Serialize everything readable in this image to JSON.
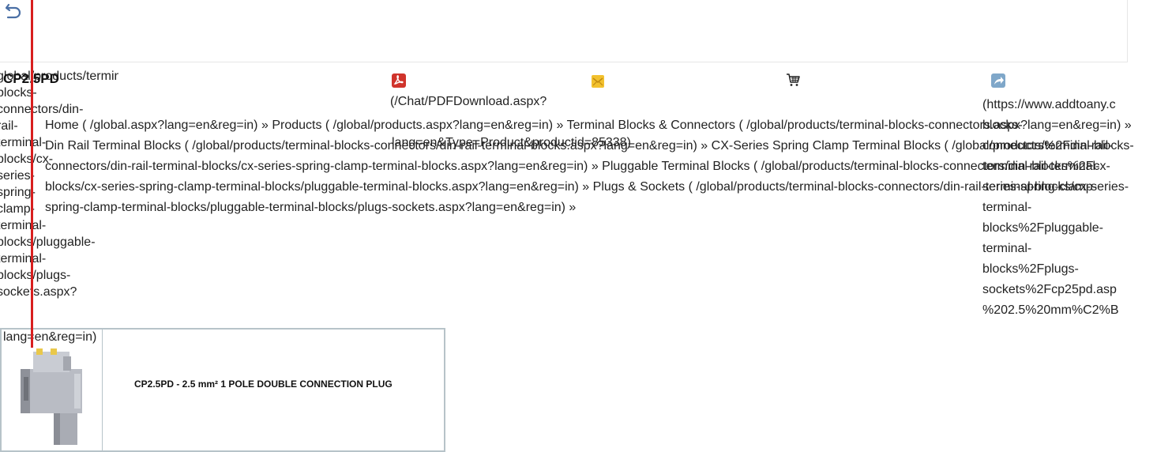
{
  "left_url": {
    "lines": [
      "global/products/terminal-",
      "blocks-",
      "connectors/din-",
      "rail-",
      "terminal-",
      "blocks/cx-",
      "series-",
      "spring-",
      "clamp-",
      "terminal-",
      "blocks/pluggable-",
      "terminal-",
      "blocks/plugs-",
      "sockets.aspx?",
      "lang=en&reg=in)"
    ]
  },
  "product_code": "CP2.5PD",
  "share": {
    "pdf_icon": "pdf-icon",
    "mail_icon": "mail-icon",
    "cart_icon": "cart-icon",
    "share_icon": "share-arrow-icon",
    "pdf_url_line1": "(/Chat/PDFDownload.aspx?",
    "pdf_url_line2": "lang=en&Type=Product&productid=85338)",
    "addtoany_lines": [
      "(https://www.addtoany.c",
      "blocks-",
      "connectors%2Fdin-rail-",
      "terminal-blocks%2Fcx-",
      "series-spring-clamp-",
      "terminal-",
      "blocks%2Fpluggable-",
      "terminal-",
      "blocks%2Fplugs-",
      "sockets%2Fcp25pd.asp",
      "%202.5%20mm%C2%B"
    ]
  },
  "breadcrumb": {
    "items": [
      {
        "label": "Home",
        "href": "( /global.aspx?lang=en&reg=in)"
      },
      {
        "label": "Products",
        "href": "( /global/products.aspx?lang=en&reg=in)"
      },
      {
        "label": "Terminal Blocks & Connectors",
        "href": "( /global/products/terminal-blocks-connectors.aspx?lang=en&reg=in)"
      },
      {
        "label": "Din Rail Terminal Blocks",
        "href": "( /global/products/terminal-blocks-connectors/din-rail-terminal-blocks.aspx?lang=en&reg=in)"
      },
      {
        "label": "CX-Series Spring Clamp Terminal Blocks",
        "href": "( /global/products/terminal-blocks-connectors/din-rail-terminal-blocks/cx-series-spring-clamp-terminal-blocks.aspx?lang=en&reg=in)"
      },
      {
        "label": "Pluggable Terminal Blocks",
        "href": "( /global/products/terminal-blocks-connectors/din-rail-terminal-blocks/cx-series-spring-clamp-terminal-blocks/pluggable-terminal-blocks.aspx?lang=en&reg=in)"
      },
      {
        "label": "Plugs & Sockets",
        "href": "( /global/products/terminal-blocks-connectors/din-rail-terminal-blocks/cx-series-spring-clamp-terminal-blocks/pluggable-terminal-blocks/plugs-sockets.aspx?lang=en&reg=in)"
      }
    ],
    "separator": "»"
  },
  "product": {
    "name": "CP2.5PD - 2.5 mm² 1 POLE DOUBLE CONNECTION PLUG",
    "image": "terminal-plug-image"
  },
  "colors": {
    "marker_line": "#d81f1f",
    "table_border": "#b7c3c9",
    "pdf_red": "#d0342c",
    "mail_yellow": "#f2c12e",
    "share_blue": "#7fa7c9"
  }
}
